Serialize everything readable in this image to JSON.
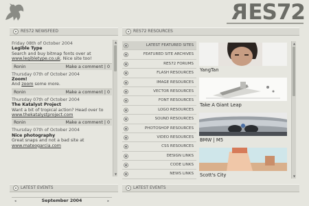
{
  "header": {
    "logo_text_reversed": "R",
    "logo_text": "ES72"
  },
  "newsfeed": {
    "title": "RES72 NEWSFEED",
    "items": [
      {
        "date": "Friday 08th of October 2004",
        "title": "Legible Type",
        "body": "Search and buy bitmap fonts over at",
        "link": "www.legibletype.co.uk",
        "tail": ". Nice site too!",
        "author": "Ronin",
        "comment_label": "Make a comment",
        "sep": "|",
        "count": "0"
      },
      {
        "date": "Thursday 07th of October 2004",
        "title": "Zoom!",
        "body": "And ",
        "link": "zoom",
        "tail": " some more.",
        "author": "Ronin",
        "comment_label": "Make a comment",
        "sep": "|",
        "count": "0"
      },
      {
        "date": "Thursday 07th of October 2004",
        "title": "The Katalyst Project",
        "body": "Want a bit of tropical action? Head over to",
        "link": "www.thekatalystproject.com",
        "tail": "",
        "author": "Ronin",
        "comment_label": "Make a comment",
        "sep": "|",
        "count": "0"
      },
      {
        "date": "Thursday 07th of October 2004",
        "title": "Nice photography",
        "body": "Great snaps and not a bad site at",
        "link": "www.mateogarcia.com",
        "tail": "",
        "author": "",
        "comment_label": "",
        "sep": "",
        "count": ""
      }
    ]
  },
  "resources": {
    "title": "RES72 RESOURCES",
    "items": [
      "LATEST FEATURED SITES",
      "FEATURED SITE ARCHIVES",
      "RES72 FORUMS",
      "FLASH RESOURCES",
      "IMAGE RESOURCES",
      "VECTOR RESOURCES",
      "FONT RESOURCES",
      "LOGO RESOURCES",
      "SOUND RESOURCES",
      "PHOTOSHOP RESOURCES",
      "VIDEO RESOURCES",
      "CSS RESOURCES",
      "DESIGN LINKS",
      "CODE LINKS",
      "NEWS LINKS"
    ],
    "featured": [
      {
        "caption": "YangTan"
      },
      {
        "caption": "Take A Giant Leap"
      },
      {
        "caption": "BMW | M5"
      },
      {
        "caption": "Scott's City"
      }
    ]
  },
  "events_left": {
    "title": "LATEST EVENTS",
    "month": "September 2004",
    "prev": "◂",
    "next": "▸"
  },
  "events_right": {
    "title": "LATEST EVENTS"
  },
  "colors": {
    "background": "#e6e6df",
    "bar": "#d8d8d1",
    "logo": "#6b6c66"
  }
}
